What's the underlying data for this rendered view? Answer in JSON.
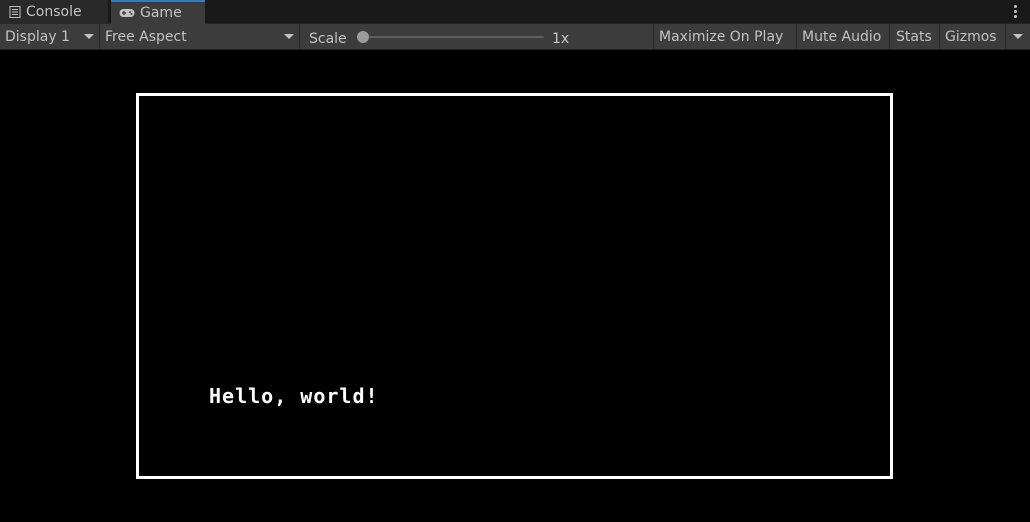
{
  "tabs": {
    "console": {
      "label": "Console",
      "icon": "console-list-icon"
    },
    "game": {
      "label": "Game",
      "icon": "gamepad-icon"
    }
  },
  "toolbar": {
    "display": "Display 1",
    "aspect": "Free Aspect",
    "scale_label": "Scale",
    "scale_value": "1x",
    "scale_fraction": 0.0,
    "maximize": "Maximize On Play",
    "mute": "Mute Audio",
    "stats": "Stats",
    "gizmos": "Gizmos"
  },
  "game": {
    "text": "Hello, world!"
  },
  "colors": {
    "tab_active_accent": "#3a79bb",
    "toolbar_bg": "#3c3c3c",
    "game_bg": "#000000",
    "frame": "#ffffff"
  }
}
